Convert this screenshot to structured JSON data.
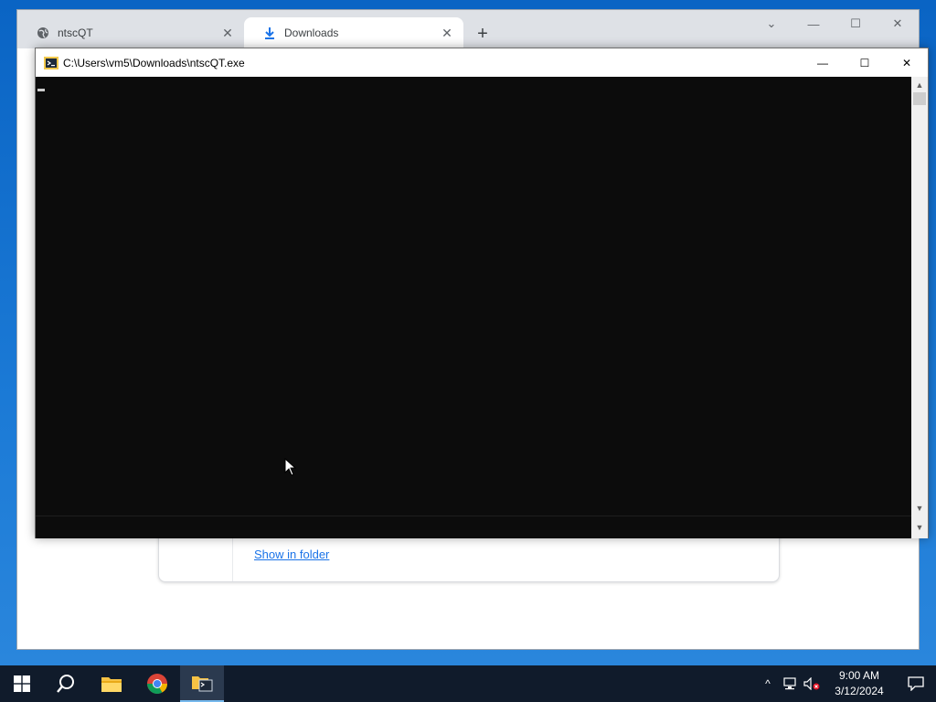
{
  "browser": {
    "tabs": [
      {
        "label": "ntscQT",
        "icon": "globe-icon",
        "close": "✕"
      },
      {
        "label": "Downloads",
        "icon": "download-icon",
        "close": "✕"
      }
    ],
    "new_tab": "+",
    "controls": {
      "dropdown": "⌄",
      "minimize": "—",
      "maximize": "☐",
      "close": "✕"
    },
    "download_card": {
      "show_in_folder": "Show in folder"
    }
  },
  "console": {
    "title": "C:\\Users\\vm5\\Downloads\\ntscQT.exe",
    "icon": "console-app-icon",
    "controls": {
      "minimize": "—",
      "maximize": "☐",
      "close": "✕"
    },
    "background_color": "#0c0c0c",
    "scroll_up": "▲",
    "scroll_down": "▼"
  },
  "taskbar": {
    "items": [
      "start-icon",
      "search-icon",
      "file-explorer-icon",
      "chrome-icon",
      "console-task-icon"
    ],
    "tray": {
      "chevron": "^",
      "time": "9:00 AM",
      "date": "3/12/2024"
    }
  }
}
